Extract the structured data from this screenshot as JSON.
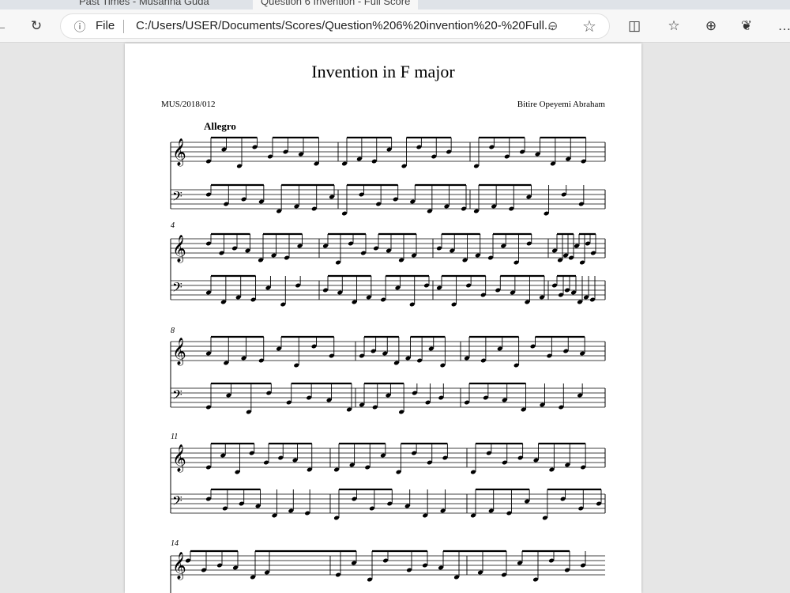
{
  "browser": {
    "tabs": [
      {
        "label": "Past Times - Musanna Guda"
      },
      {
        "label": "Question 6 Invention - Full Score"
      }
    ],
    "address": {
      "file_label": "File",
      "url": "C:/Users/USER/Documents/Scores/Question%206%20invention%20-%20Full..."
    },
    "icons": {
      "back": "back-arrow-icon",
      "refresh": "refresh-icon",
      "info": "info-icon",
      "zoom": "zoom-icon",
      "favorite": "star-icon",
      "split": "split-screen-icon",
      "favorites": "favorites-list-icon",
      "collections": "collections-icon",
      "extensions": "copilot-icon",
      "menu": "more-menu-icon"
    }
  },
  "document": {
    "title": "Invention in F major",
    "matric": "MUS/2018/012",
    "author": "Bitire Opeyemi Abraham",
    "tempo": "Allegro",
    "measure_numbers": [
      "4",
      "8",
      "11",
      "14"
    ]
  }
}
